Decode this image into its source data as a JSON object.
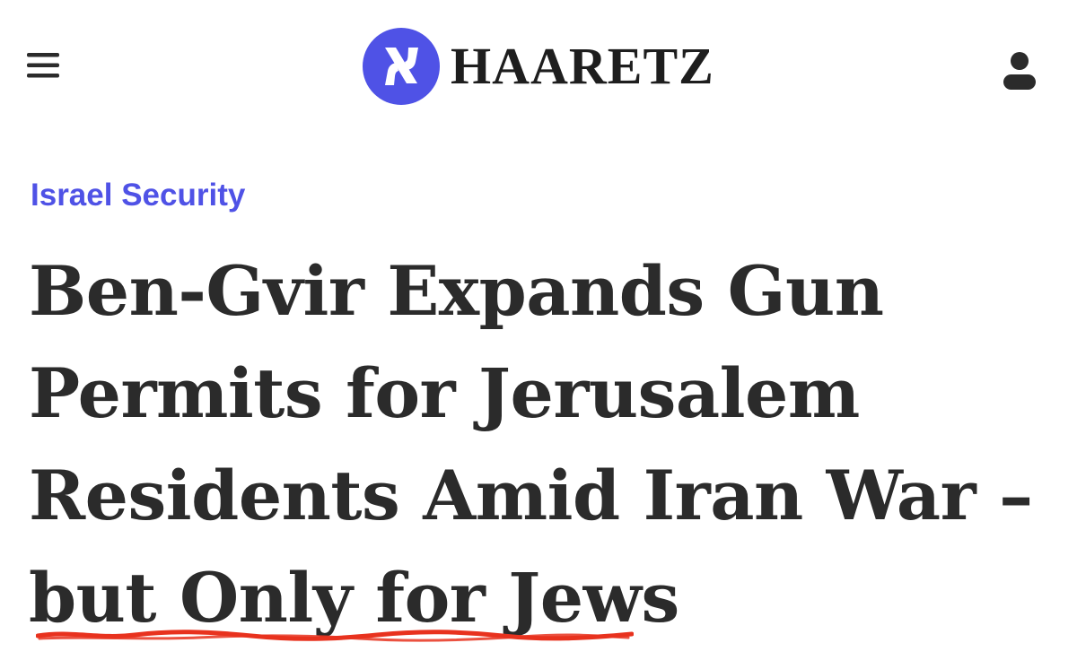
{
  "header": {
    "brand": "HAARETZ",
    "menu_icon": "hamburger-menu-icon",
    "logo_icon": "haaretz-logo-icon",
    "account_icon": "user-account-icon"
  },
  "article": {
    "section": "Israel Security",
    "headline_lines": [
      "Ben-Gvir Expands Gun",
      "Permits for Jerusalem",
      "Residents Amid Iran War –",
      "but Only for Jews"
    ]
  },
  "colors": {
    "accent": "#4f52e6",
    "headline": "#2b2b2b",
    "underline": "#e8321e",
    "background": "#ffffff"
  }
}
